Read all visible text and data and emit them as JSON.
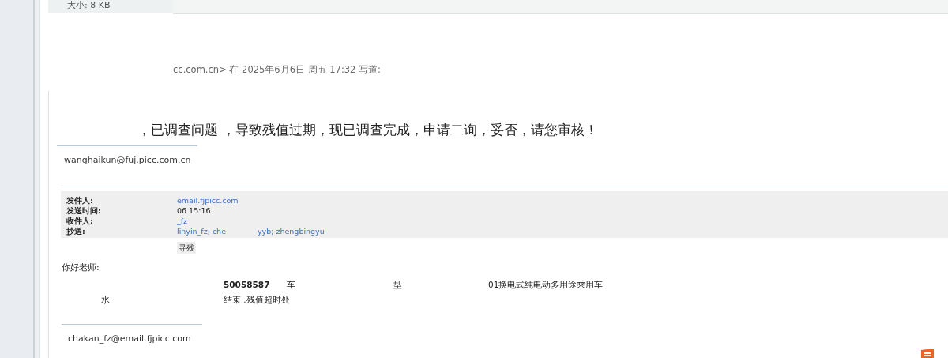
{
  "attachment_size": "大小: 8 KB",
  "reply_header": "cc.com.cn> 在 2025年6月6日 周五 17:32 写道:",
  "quoted": {
    "body": "，已调查问题 ，导致残值过期，现已调查完成，申请二询，妥否，请您审核！",
    "signature": "wanghaikun@fuj.picc.com.cn",
    "forwarded": {
      "fields": [
        {
          "label": "发件人:",
          "segments": [
            {
              "text": "email.fjpicc.com",
              "link": true
            }
          ]
        },
        {
          "label": "发送时间:",
          "segments": [
            {
              "text": "06 15:16",
              "link": false
            }
          ]
        },
        {
          "label": "收件人:",
          "segments": [
            {
              "text": "_fz",
              "link": true
            }
          ]
        },
        {
          "label": "抄送:",
          "segments": [
            {
              "text": "linyin_fz; che",
              "link": true
            },
            {
              "text": "yyb; zhengbingyu",
              "link": true
            }
          ]
        }
      ],
      "subject_fragment": "寻残",
      "greeting": "你好老师:",
      "rows": [
        [
          null,
          {
            "text": "50058587",
            "bold": true
          },
          {
            "text": "车",
            "bold": false
          },
          {
            "text": "型",
            "bold": false
          },
          {
            "text": "01换电式纯电动多用途乘用车",
            "bold": false
          }
        ],
        [
          {
            "text": "水",
            "bold": false
          },
          {
            "text": "结束 .残值超时处",
            "bold": false
          }
        ]
      ],
      "signature": "chakan_fz@email.fjpicc.com"
    }
  }
}
